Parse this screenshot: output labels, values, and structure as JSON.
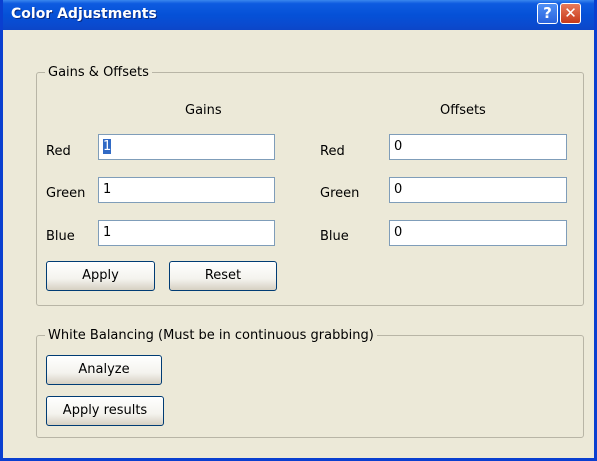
{
  "window": {
    "title": "Color Adjustments"
  },
  "title_buttons": {
    "help": "?",
    "close": "✕"
  },
  "gains_offsets": {
    "legend": "Gains & Offsets",
    "gains_header": "Gains",
    "offsets_header": "Offsets",
    "gains": [
      {
        "label": "Red",
        "value": "1"
      },
      {
        "label": "Green",
        "value": "1"
      },
      {
        "label": "Blue",
        "value": "1"
      }
    ],
    "offsets": [
      {
        "label": "Red",
        "value": "0"
      },
      {
        "label": "Green",
        "value": "0"
      },
      {
        "label": "Blue",
        "value": "0"
      }
    ],
    "apply_label": "Apply",
    "reset_label": "Reset"
  },
  "white_balance": {
    "legend": "White Balancing (Must be in continuous grabbing)",
    "analyze_label": "Analyze",
    "apply_results_label": "Apply results"
  }
}
